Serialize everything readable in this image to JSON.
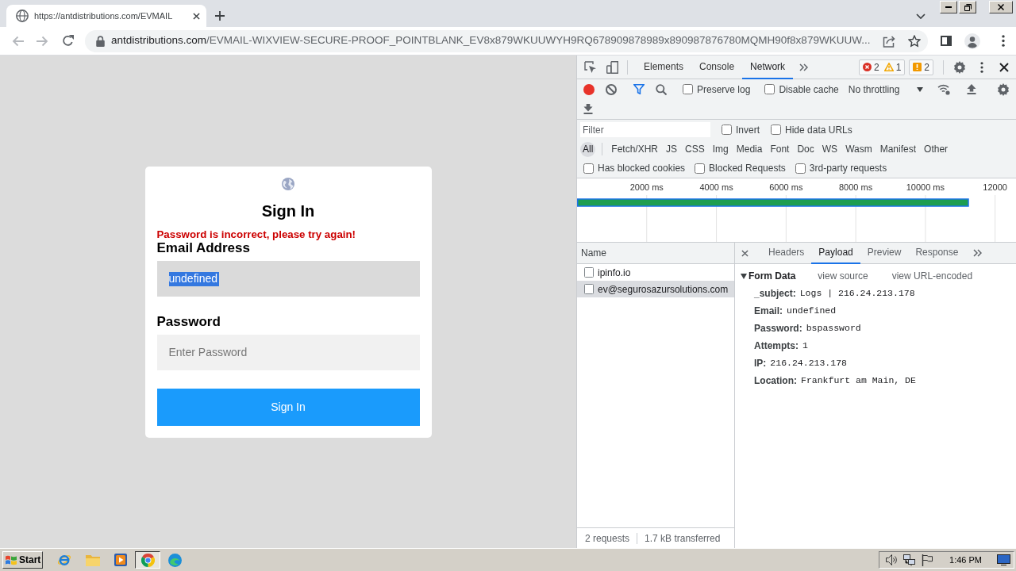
{
  "browser": {
    "tab": {
      "title": "https://antdistributions.com/EVMAIL"
    },
    "address": {
      "host": "antdistributions.com",
      "path": "/EVMAIL-WIXVIEW-SECURE-PROOF_POINTBLANK_EV8x879WKUUWYH9RQ678909878989x890987876780MQMH90f8x879WKUUW..."
    }
  },
  "page": {
    "title": "Sign In",
    "error": "Password is incorrect, please try again!",
    "fields": [
      {
        "kind": "text",
        "label": "Email Address",
        "value": "undefined",
        "text_selected": true
      },
      {
        "kind": "password",
        "label": "Password",
        "placeholder": "Enter Password"
      }
    ],
    "button": "Sign In"
  },
  "devtools": {
    "tabs": [
      {
        "label": "Elements",
        "selected": false
      },
      {
        "label": "Console",
        "selected": false
      },
      {
        "label": "Network",
        "selected": true
      }
    ],
    "counts": {
      "errors": "2",
      "warnings": "1",
      "issues": "2"
    },
    "toolbar": {
      "recording": true,
      "options": [
        {
          "label": "Preserve log",
          "checked": false
        },
        {
          "label": "Disable cache",
          "checked": false
        }
      ],
      "throttling": "No throttling"
    },
    "filter": {
      "placeholder": "Filter",
      "options": [
        {
          "label": "Invert",
          "checked": false
        },
        {
          "label": "Hide data URLs",
          "checked": false
        }
      ]
    },
    "types": [
      {
        "label": "All",
        "selected": true
      },
      {
        "label": "Fetch/XHR",
        "selected": false
      },
      {
        "label": "JS",
        "selected": false
      },
      {
        "label": "CSS",
        "selected": false
      },
      {
        "label": "Img",
        "selected": false
      },
      {
        "label": "Media",
        "selected": false
      },
      {
        "label": "Font",
        "selected": false
      },
      {
        "label": "Doc",
        "selected": false
      },
      {
        "label": "WS",
        "selected": false
      },
      {
        "label": "Wasm",
        "selected": false
      },
      {
        "label": "Manifest",
        "selected": false
      },
      {
        "label": "Other",
        "selected": false
      }
    ],
    "extra_filters": [
      {
        "label": "Has blocked cookies",
        "checked": false
      },
      {
        "label": "Blocked Requests",
        "checked": false
      },
      {
        "label": "3rd-party requests",
        "checked": false
      }
    ],
    "overview": {
      "chart_data": [
        {
          "type": "bar",
          "orientation": "horizontal",
          "categories": [
            null
          ],
          "values": [
            11250
          ],
          "color": "#1e9e50",
          "xlim": [
            0,
            12600
          ],
          "xticks": [
            {
              "value": 2000,
              "label": "2000 ms"
            },
            {
              "value": 4000,
              "label": "4000 ms"
            },
            {
              "value": 6000,
              "label": "6000 ms"
            },
            {
              "value": 8000,
              "label": "8000 ms"
            },
            {
              "value": 10000,
              "label": "10000 ms"
            },
            {
              "value": 12000,
              "label": "12000"
            }
          ],
          "tick_labels": "x",
          "grid": true
        }
      ]
    },
    "requests": {
      "column": "Name",
      "rows": [
        {
          "name": "ipinfo.io",
          "selected": false
        },
        {
          "name": "ev@segurosazursolutions.com",
          "selected": true
        }
      ]
    },
    "detail": {
      "tabs": [
        {
          "label": "Headers",
          "selected": false
        },
        {
          "label": "Payload",
          "selected": true
        },
        {
          "label": "Preview",
          "selected": false
        },
        {
          "label": "Response",
          "selected": false
        }
      ],
      "section": {
        "title": "Form Data",
        "expanded": true,
        "links": [
          "view source",
          "view URL-encoded"
        ],
        "rows": [
          {
            "key": "_subject:",
            "value": "Logs | 216.24.213.178"
          },
          {
            "key": "Email:",
            "value": "undefined"
          },
          {
            "key": "Password:",
            "value": "bspassword"
          },
          {
            "key": "Attempts:",
            "value": "1"
          },
          {
            "key": "IP:",
            "value": "216.24.213.178"
          },
          {
            "key": "Location:",
            "value": "Frankfurt am Main, DE"
          }
        ]
      }
    },
    "summary": [
      "2 requests",
      "1.7 kB transferred"
    ]
  },
  "taskbar": {
    "start": "Start",
    "time": "1:46 PM"
  }
}
